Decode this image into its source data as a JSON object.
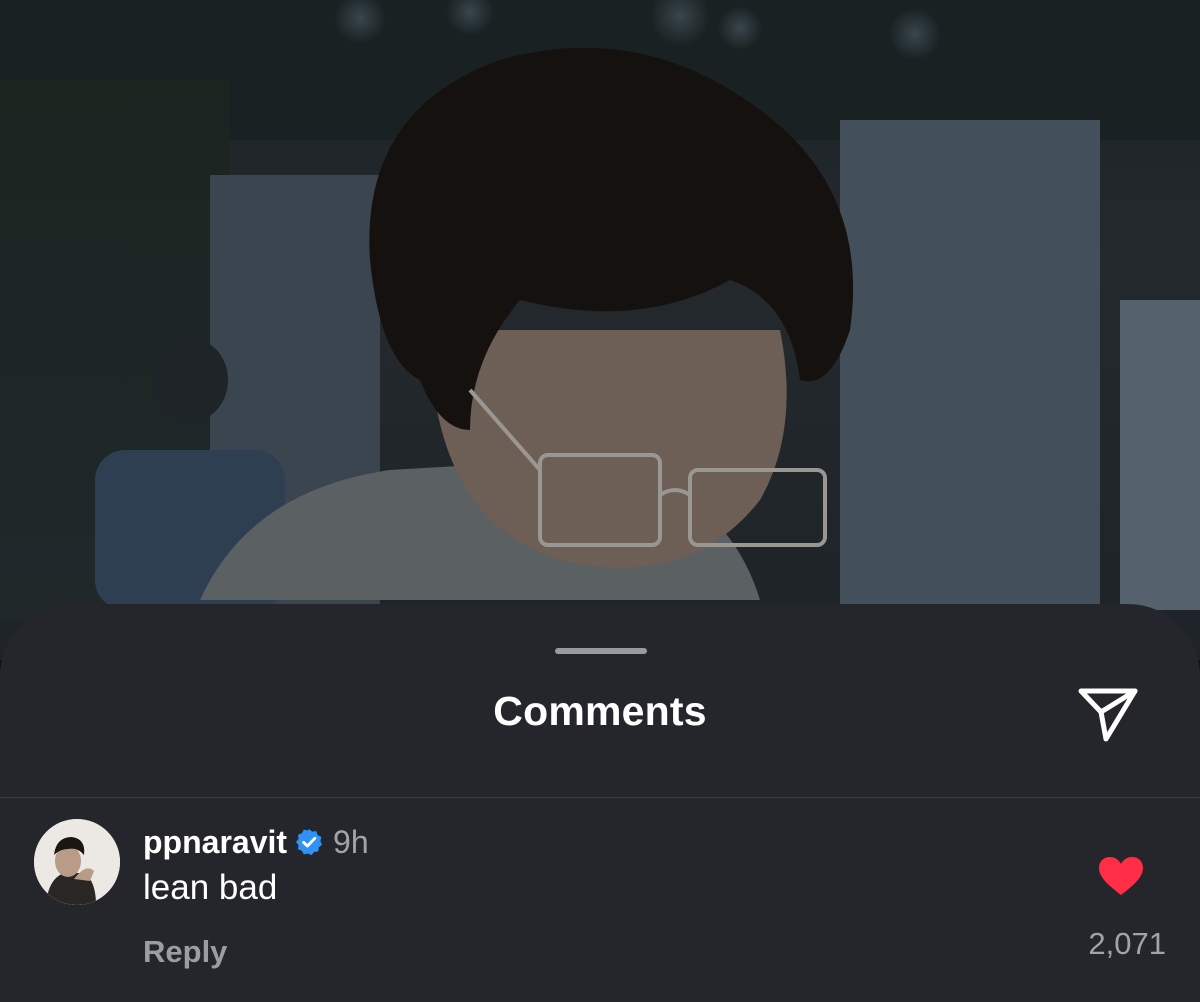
{
  "background": {
    "description_icon": "video-frame"
  },
  "sheet": {
    "title": "Comments",
    "share_icon": "send-icon"
  },
  "comments": [
    {
      "username": "ppnaravit",
      "verified": true,
      "timestamp": "9h",
      "text": "lean bad",
      "reply_label": "Reply",
      "liked": true,
      "like_count": "2,071"
    }
  ],
  "colors": {
    "sheet_bg": "#25262b",
    "verified_blue": "#2f93f5",
    "like_red": "#ff2d46",
    "secondary_text": "#a2a3a9"
  }
}
